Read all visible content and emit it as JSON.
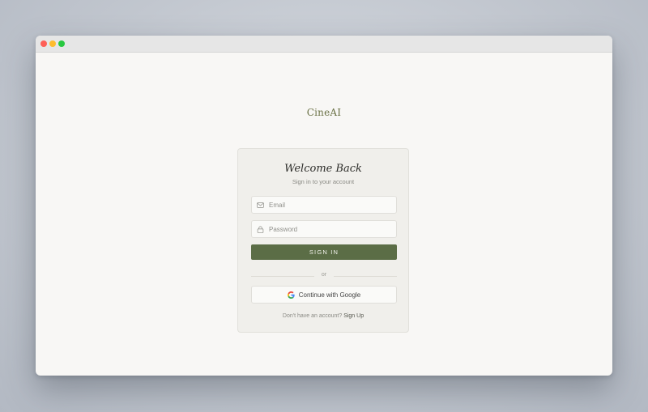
{
  "app": {
    "logo": "CineAI"
  },
  "login": {
    "heading": "Welcome Back",
    "subheading": "Sign in to your account",
    "email_placeholder": "Email",
    "password_placeholder": "Password",
    "signin_label": "SIGN IN",
    "divider_text": "or",
    "google_label": "Continue with Google",
    "footer_text": "Don't have an account?",
    "signup_label": "Sign Up"
  },
  "icons": {
    "email": "mail-icon",
    "password": "lock-icon",
    "google": "google-icon"
  },
  "colors": {
    "accent": "#5b6d46",
    "logo": "#6b7246",
    "window_bg": "#f8f7f5",
    "card_bg": "#f0efeb"
  }
}
